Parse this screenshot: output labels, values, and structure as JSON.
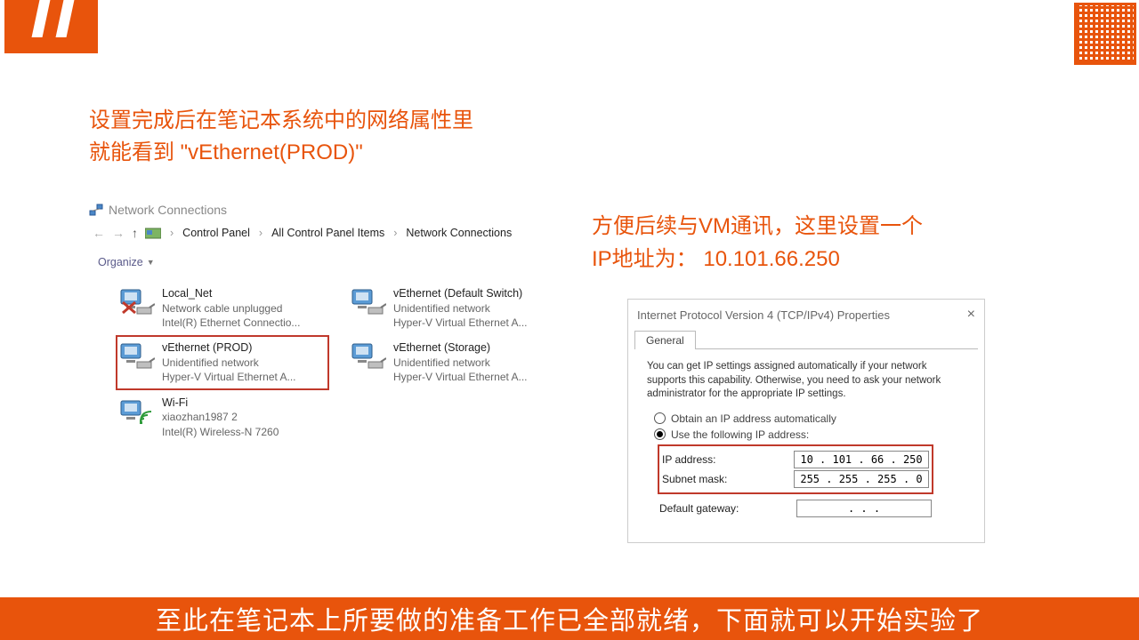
{
  "headline_line1": "设置完成后在笔记本系统中的网络属性里",
  "headline_line2": "就能看到 \"vEthernet(PROD)\"",
  "headline2_line1": "方便后续与VM通讯，这里设置一个",
  "headline2_line2": "IP地址为： 10.101.66.250",
  "nc": {
    "window_title": "Network Connections",
    "breadcrumb": [
      "Control Panel",
      "All Control Panel Items",
      "Network Connections"
    ],
    "organize": "Organize",
    "adapters": [
      {
        "name": "Local_Net",
        "line2": "Network cable unplugged",
        "line3": "Intel(R) Ethernet Connectio...",
        "disabled": true
      },
      {
        "name": "vEthernet (Default Switch)",
        "line2": "Unidentified network",
        "line3": "Hyper-V Virtual Ethernet A..."
      },
      {
        "name": "vEthernet (PROD)",
        "line2": "Unidentified network",
        "line3": "Hyper-V Virtual Ethernet A...",
        "highlight": true
      },
      {
        "name": "vEthernet (Storage)",
        "line2": "Unidentified network",
        "line3": "Hyper-V Virtual Ethernet A..."
      },
      {
        "name": "Wi-Fi",
        "line2": "xiaozhan1987 2",
        "line3": "Intel(R) Wireless-N 7260",
        "wifi": true
      }
    ]
  },
  "ipv4": {
    "title": "Internet Protocol Version 4 (TCP/IPv4) Properties",
    "tab": "General",
    "desc": "You can get IP settings assigned automatically if your network supports this capability. Otherwise, you need to ask your network administrator for the appropriate IP settings.",
    "radio_auto": "Obtain an IP address automatically",
    "radio_manual": "Use the following IP address:",
    "labels": {
      "ip": "IP address:",
      "mask": "Subnet mask:",
      "gw": "Default gateway:"
    },
    "values": {
      "ip": "10 . 101 . 66 . 250",
      "mask": "255 . 255 . 255 .  0",
      "gw": ".       .       ."
    }
  },
  "footer": "至此在笔记本上所要做的准备工作已全部就绪，下面就可以开始实验了"
}
